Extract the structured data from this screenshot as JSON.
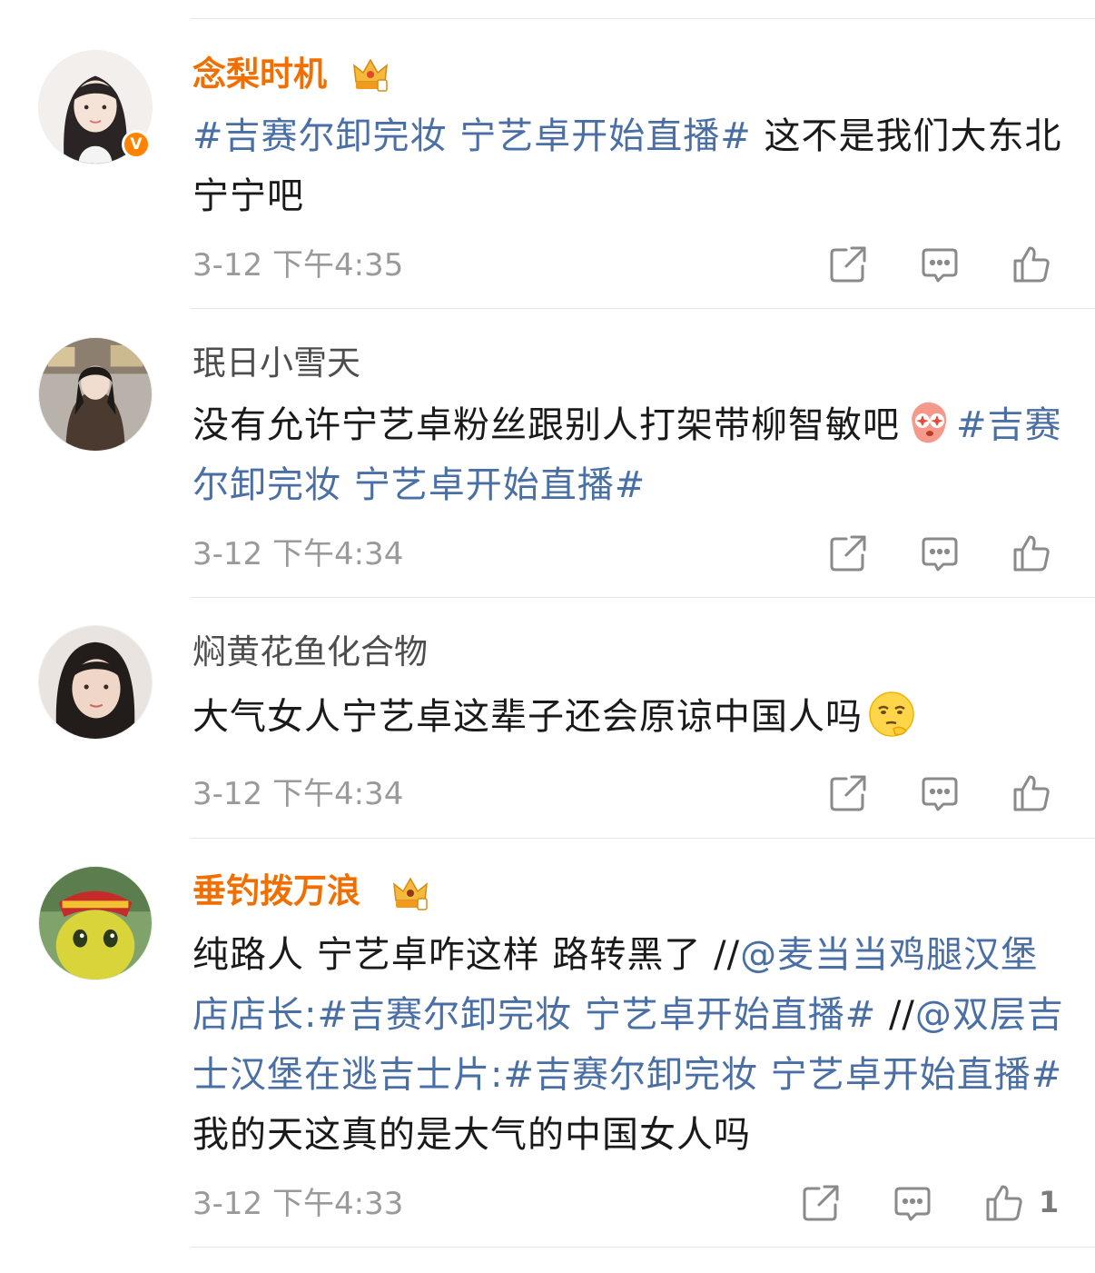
{
  "comments": [
    {
      "username": "念梨时机",
      "vip": true,
      "verified": true,
      "parts": [
        {
          "type": "tag",
          "text": "#吉赛尔卸完妆 宁艺卓开始直播#"
        },
        {
          "type": "text",
          "text": " 这不是我们大东北宁宁吧"
        }
      ],
      "time": "3-12 下午4:35",
      "likes": ""
    },
    {
      "username": "珉日小雪天",
      "vip": false,
      "verified": false,
      "parts": [
        {
          "type": "text",
          "text": "没有允许宁艺卓粉丝跟别人打架带柳智敏吧"
        },
        {
          "type": "emoji",
          "name": "starry-eyed-emoji"
        },
        {
          "type": "tag",
          "text": "#吉赛尔卸完妆 宁艺卓开始直播#"
        }
      ],
      "time": "3-12 下午4:34",
      "likes": ""
    },
    {
      "username": "焖黄花鱼化合物",
      "vip": false,
      "verified": false,
      "parts": [
        {
          "type": "text",
          "text": "大气女人宁艺卓这辈子还会原谅中国人吗"
        },
        {
          "type": "emoji",
          "name": "thinking-face-emoji"
        }
      ],
      "time": "3-12 下午4:34",
      "likes": ""
    },
    {
      "username": "垂钓拨万浪",
      "vip": true,
      "verified": false,
      "parts": [
        {
          "type": "text",
          "text": "纯路人 宁艺卓咋这样 路转黑了 "
        },
        {
          "type": "plain",
          "text": "//"
        },
        {
          "type": "tag",
          "text": "@麦当当鸡腿汉堡店店长"
        },
        {
          "type": "text",
          "text": ":"
        },
        {
          "type": "tag",
          "text": "#吉赛尔卸完妆 宁艺卓开始直播#"
        },
        {
          "type": "text",
          "text": " "
        },
        {
          "type": "plain",
          "text": "//"
        },
        {
          "type": "tag",
          "text": "@双层吉士汉堡在逃吉士片"
        },
        {
          "type": "text",
          "text": ":"
        },
        {
          "type": "tag",
          "text": "#吉赛尔卸完妆 宁艺卓开始直播#"
        },
        {
          "type": "text",
          "text": " 我的天这真的是大气的中国女人吗"
        }
      ],
      "time": "3-12 下午4:33",
      "likes": "1"
    }
  ],
  "colors": {
    "vip_name": "#f06f00",
    "tag_link": "#4a6fa5",
    "verified_badge": "#ff8200",
    "meta_gray": "#9a9a9a"
  },
  "icons": {
    "share": "share-icon",
    "comment": "comment-icon",
    "like": "thumbs-up-icon",
    "vip": "crown-vip-icon",
    "verified": "verified-badge-icon"
  }
}
